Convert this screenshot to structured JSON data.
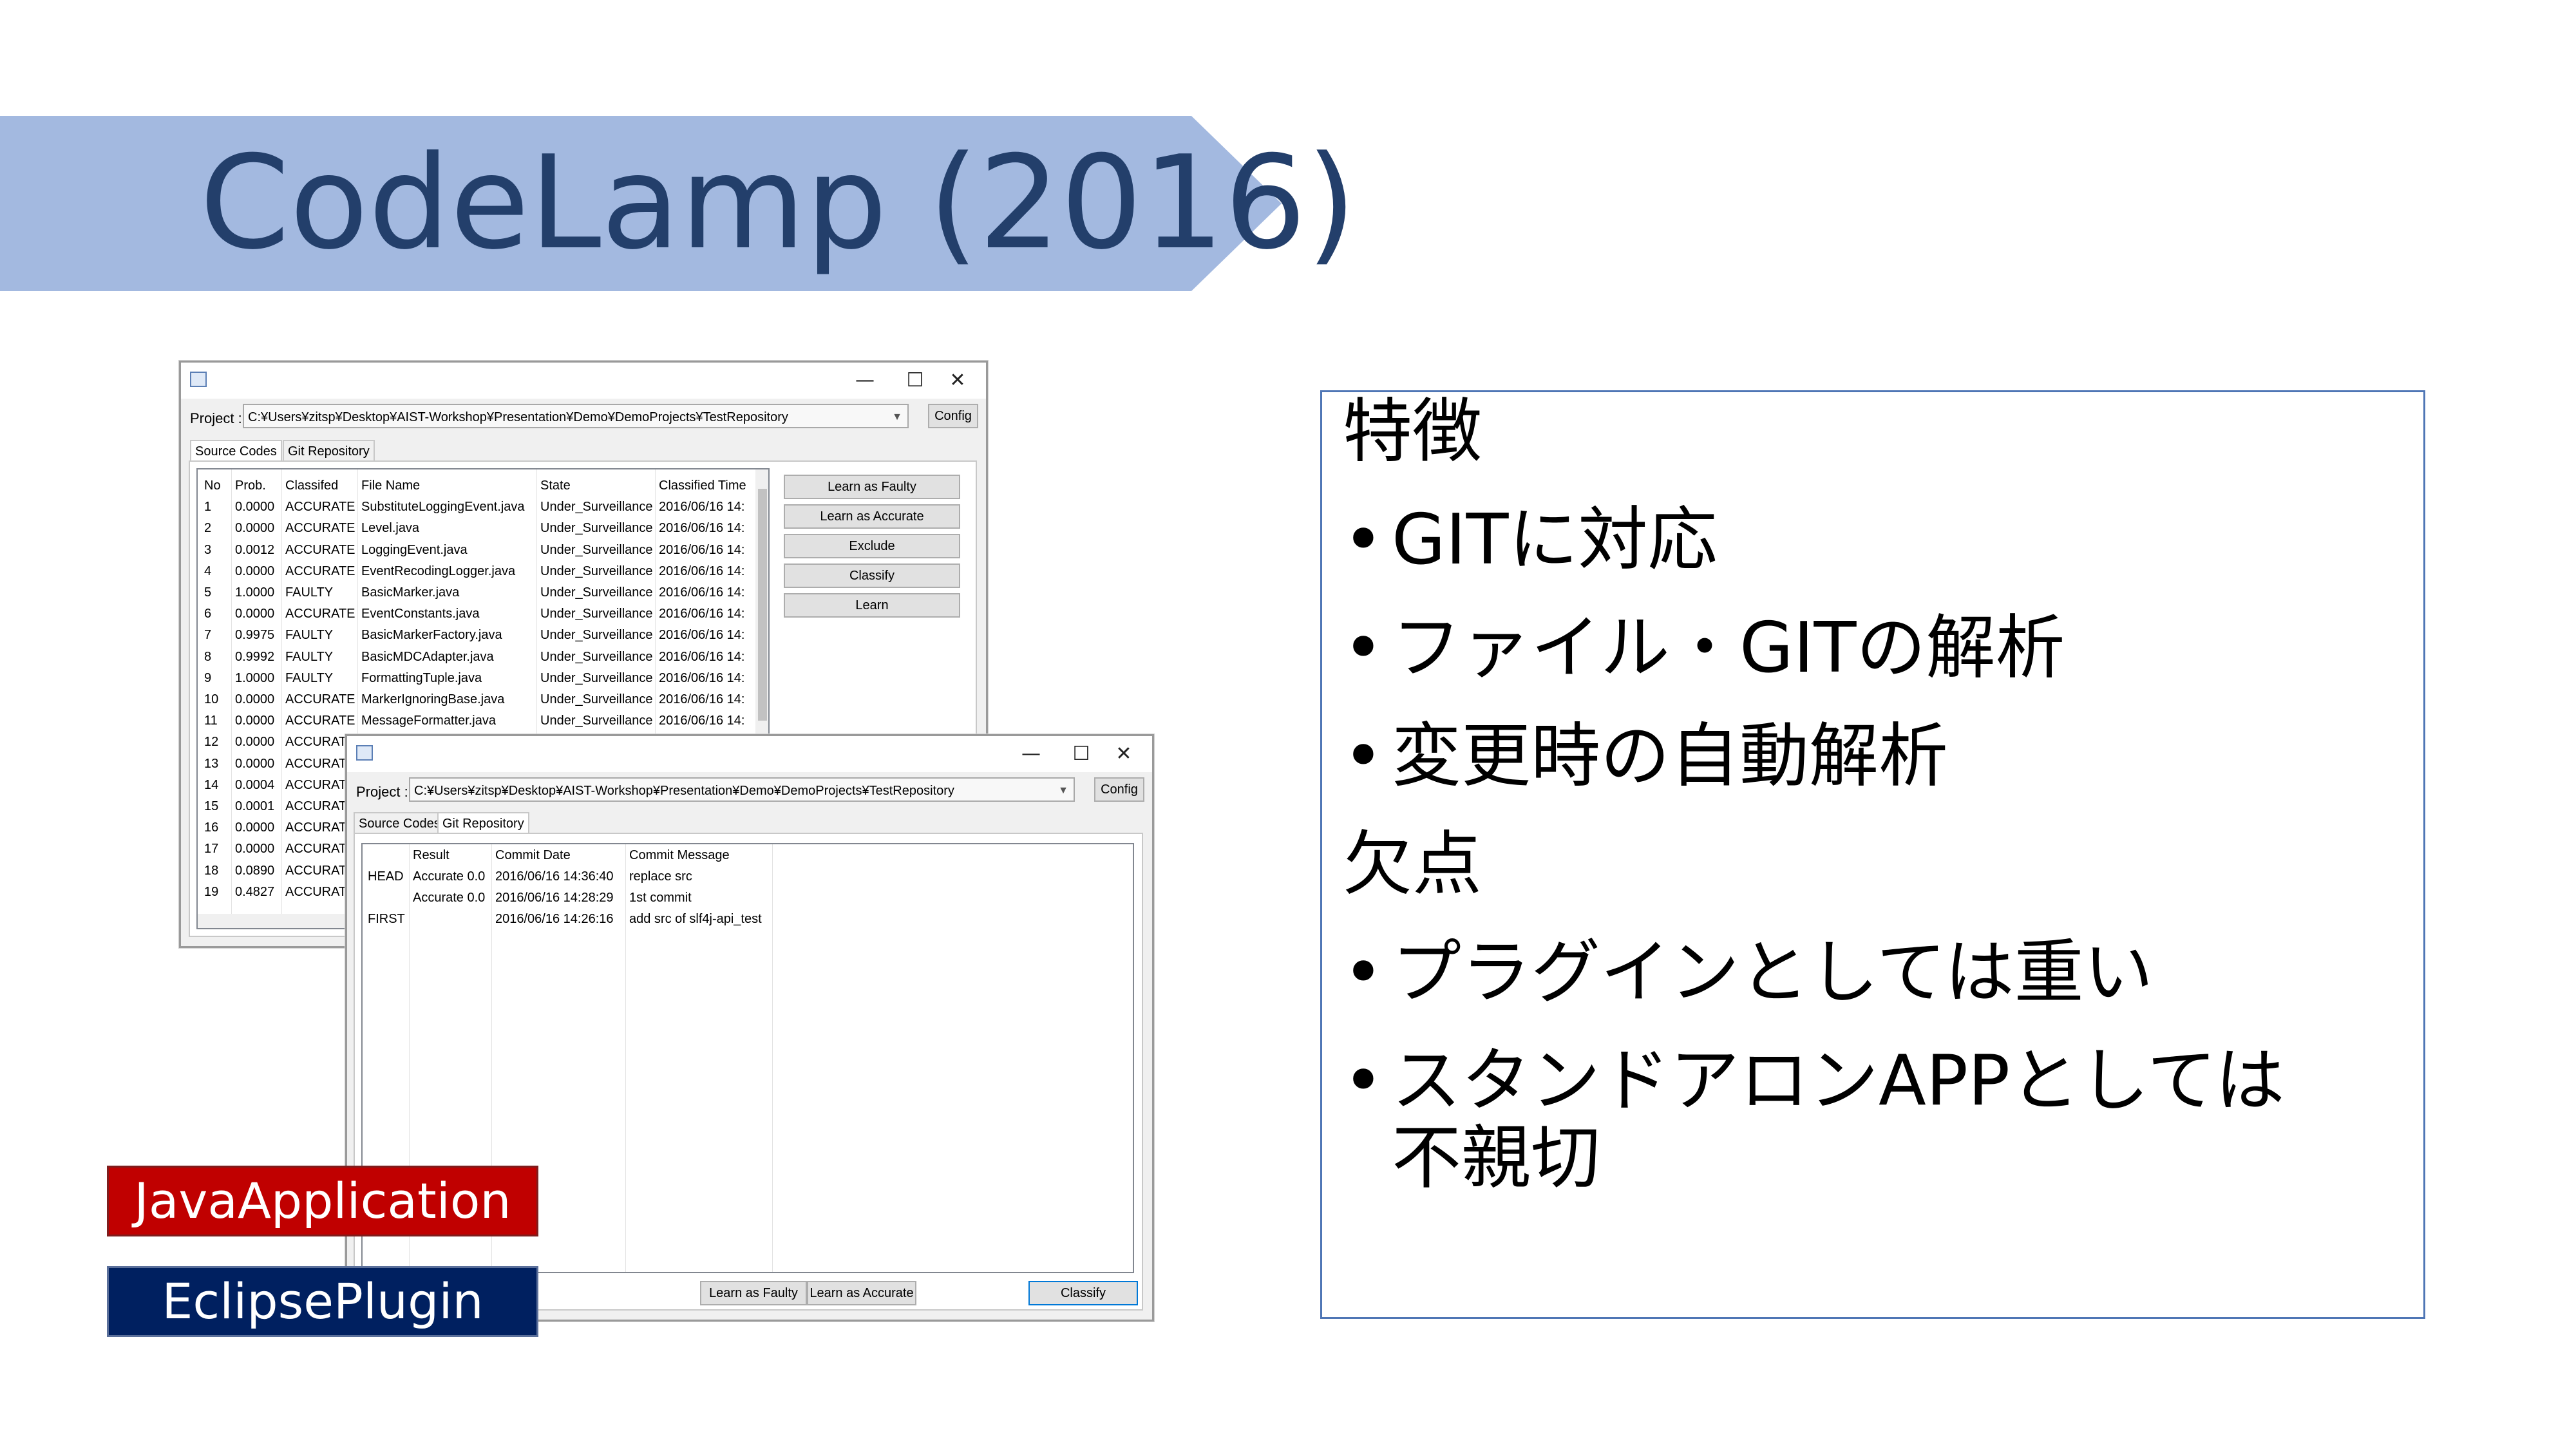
{
  "slide": {
    "title": "CodeLamp (2016)"
  },
  "window1": {
    "title_icon": "app-icon",
    "controls": {
      "minimize": "—",
      "maximize": "☐",
      "close": "✕"
    },
    "project_label": "Project :",
    "project_path": "C:¥Users¥zitsp¥Desktop¥AIST-Workshop¥Presentation¥Demo¥DemoProjects¥TestRepository",
    "config_label": "Config",
    "tabs": [
      "Source Codes",
      "Git Repository"
    ],
    "table": {
      "headers": [
        "No",
        "Prob.",
        "Classifed",
        "File Name",
        "State",
        "Classified Time"
      ],
      "rows": [
        [
          "1",
          "0.0000",
          "ACCURATE",
          "SubstituteLoggingEvent.java",
          "Under_Surveillance",
          "2016/06/16 14:"
        ],
        [
          "2",
          "0.0000",
          "ACCURATE",
          "Level.java",
          "Under_Surveillance",
          "2016/06/16 14:"
        ],
        [
          "3",
          "0.0012",
          "ACCURATE",
          "LoggingEvent.java",
          "Under_Surveillance",
          "2016/06/16 14:"
        ],
        [
          "4",
          "0.0000",
          "ACCURATE",
          "EventRecodingLogger.java",
          "Under_Surveillance",
          "2016/06/16 14:"
        ],
        [
          "5",
          "1.0000",
          "FAULTY",
          "BasicMarker.java",
          "Under_Surveillance",
          "2016/06/16 14:"
        ],
        [
          "6",
          "0.0000",
          "ACCURATE",
          "EventConstants.java",
          "Under_Surveillance",
          "2016/06/16 14:"
        ],
        [
          "7",
          "0.9975",
          "FAULTY",
          "BasicMarkerFactory.java",
          "Under_Surveillance",
          "2016/06/16 14:"
        ],
        [
          "8",
          "0.9992",
          "FAULTY",
          "BasicMDCAdapter.java",
          "Under_Surveillance",
          "2016/06/16 14:"
        ],
        [
          "9",
          "1.0000",
          "FAULTY",
          "FormattingTuple.java",
          "Under_Surveillance",
          "2016/06/16 14:"
        ],
        [
          "10",
          "0.0000",
          "ACCURATE",
          "MarkerIgnoringBase.java",
          "Under_Surveillance",
          "2016/06/16 14:"
        ],
        [
          "11",
          "0.0000",
          "ACCURATE",
          "MessageFormatter.java",
          "Under_Surveillance",
          "2016/06/16 14:"
        ],
        [
          "12",
          "0.0000",
          "ACCURATI",
          "",
          "",
          ""
        ],
        [
          "13",
          "0.0000",
          "ACCURATI",
          "",
          "",
          ""
        ],
        [
          "14",
          "0.0004",
          "ACCURATI",
          "",
          "",
          ""
        ],
        [
          "15",
          "0.0001",
          "ACCURATI",
          "",
          "",
          ""
        ],
        [
          "16",
          "0.0000",
          "ACCURATI",
          "",
          "",
          ""
        ],
        [
          "17",
          "0.0000",
          "ACCURATI",
          "",
          "",
          ""
        ],
        [
          "18",
          "0.0890",
          "ACCURATI",
          "",
          "",
          ""
        ],
        [
          "19",
          "0.4827",
          "ACCURATI",
          "",
          "",
          ""
        ]
      ]
    },
    "buttons": [
      "Learn as Faulty",
      "Learn as Accurate",
      "Exclude",
      "Classify",
      "Learn"
    ]
  },
  "window2": {
    "title_icon": "app-icon",
    "controls": {
      "minimize": "—",
      "maximize": "☐",
      "close": "✕"
    },
    "project_label": "Project :",
    "project_path": "C:¥Users¥zitsp¥Desktop¥AIST-Workshop¥Presentation¥Demo¥DemoProjects¥TestRepository",
    "config_label": "Config",
    "tabs": [
      "Source Codes",
      "Git Repository"
    ],
    "table": {
      "headers": [
        "",
        "Result",
        "Commit Date",
        "Commit Message"
      ],
      "rows": [
        [
          "HEAD",
          "Accurate 0.0",
          "2016/06/16 14:36:40",
          "replace src"
        ],
        [
          "",
          "Accurate 0.0",
          "2016/06/16 14:28:29",
          "1st commit"
        ],
        [
          "FIRST",
          "",
          "2016/06/16 14:26:16",
          "add src of slf4j-api_test"
        ]
      ]
    },
    "buttons": [
      "Learn as Faulty",
      "Learn as Accurate",
      "Classify"
    ]
  },
  "features_box": {
    "heading": "特徴",
    "features": [
      "GITに対応",
      "ファイル・GITの解析",
      "変更時の自動解析"
    ],
    "cons_heading": "欠点",
    "cons": [
      "プラグインとしては重い",
      "スタンドアロンAPPとしては",
      "不親切"
    ],
    "bullet": "•"
  },
  "tags": {
    "java": "JavaApplication",
    "eclipse": "EclipsePlugin"
  },
  "colors": {
    "banner": "#a3b9e0",
    "title_text": "#233f6b",
    "java_tag": "#c00000",
    "eclipse_tag": "#002060",
    "features_border": "#4f76b5"
  }
}
